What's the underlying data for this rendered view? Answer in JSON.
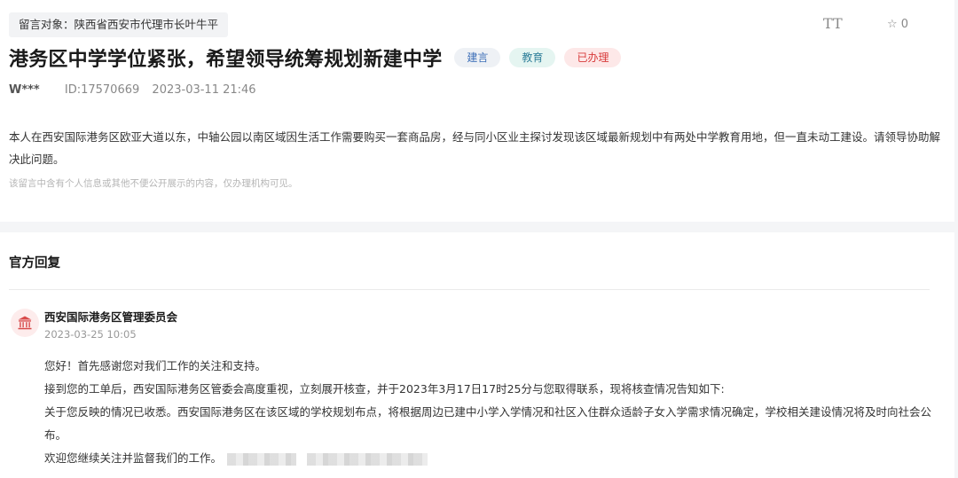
{
  "message": {
    "target_label": "留言对象：陕西省西安市代理市长叶牛平",
    "toolbar": {
      "font_size_icon": "TT",
      "favorite_icon": "☆",
      "favorite_count": "0"
    },
    "title": "港务区中学学位紧张，希望领导统筹规划新建中学",
    "badges": {
      "type": "建言",
      "category": "教育",
      "status": "已办理"
    },
    "user": "W***",
    "id_text": "ID:17570669",
    "datetime": "2023-03-11 21:46",
    "content": "本人在西安国际港务区欧亚大道以东，中轴公园以南区域因生活工作需要购买一套商品房，经与同小区业主探讨发现该区域最新规划中有两处中学教育用地，但一直未动工建设。请领导协助解决此问题。",
    "privacy_note": "该留言中含有个人信息或其他不便公开展示的内容，仅办理机构可见。"
  },
  "reply": {
    "heading": "官方回复",
    "org_icon": "government-building-icon",
    "org_name": "西安国际港务区管理委员会",
    "date": "2023-03-25 10:05",
    "lines": {
      "l1": "您好！首先感谢您对我们工作的关注和支持。",
      "l2": "接到您的工单后，西安国际港务区管委会高度重视，立刻展开核查，并于2023年3月17日17时25分与您取得联系，现将核查情况告知如下:",
      "l3": "关于您反映的情况已收悉。西安国际港务区在该区域的学校规划布点，将根据周边已建中小学入学情况和社区入住群众适龄子女入学需求情况确定，学校相关建设情况将及时向社会公布。",
      "l4": "欢迎您继续关注并监督我们的工作。"
    }
  },
  "colors": {
    "badge_type_text": "#3d6fb8",
    "badge_category_text": "#2f7f9a",
    "badge_status_text": "#d83a3a",
    "org_icon": "#d84a4a"
  }
}
